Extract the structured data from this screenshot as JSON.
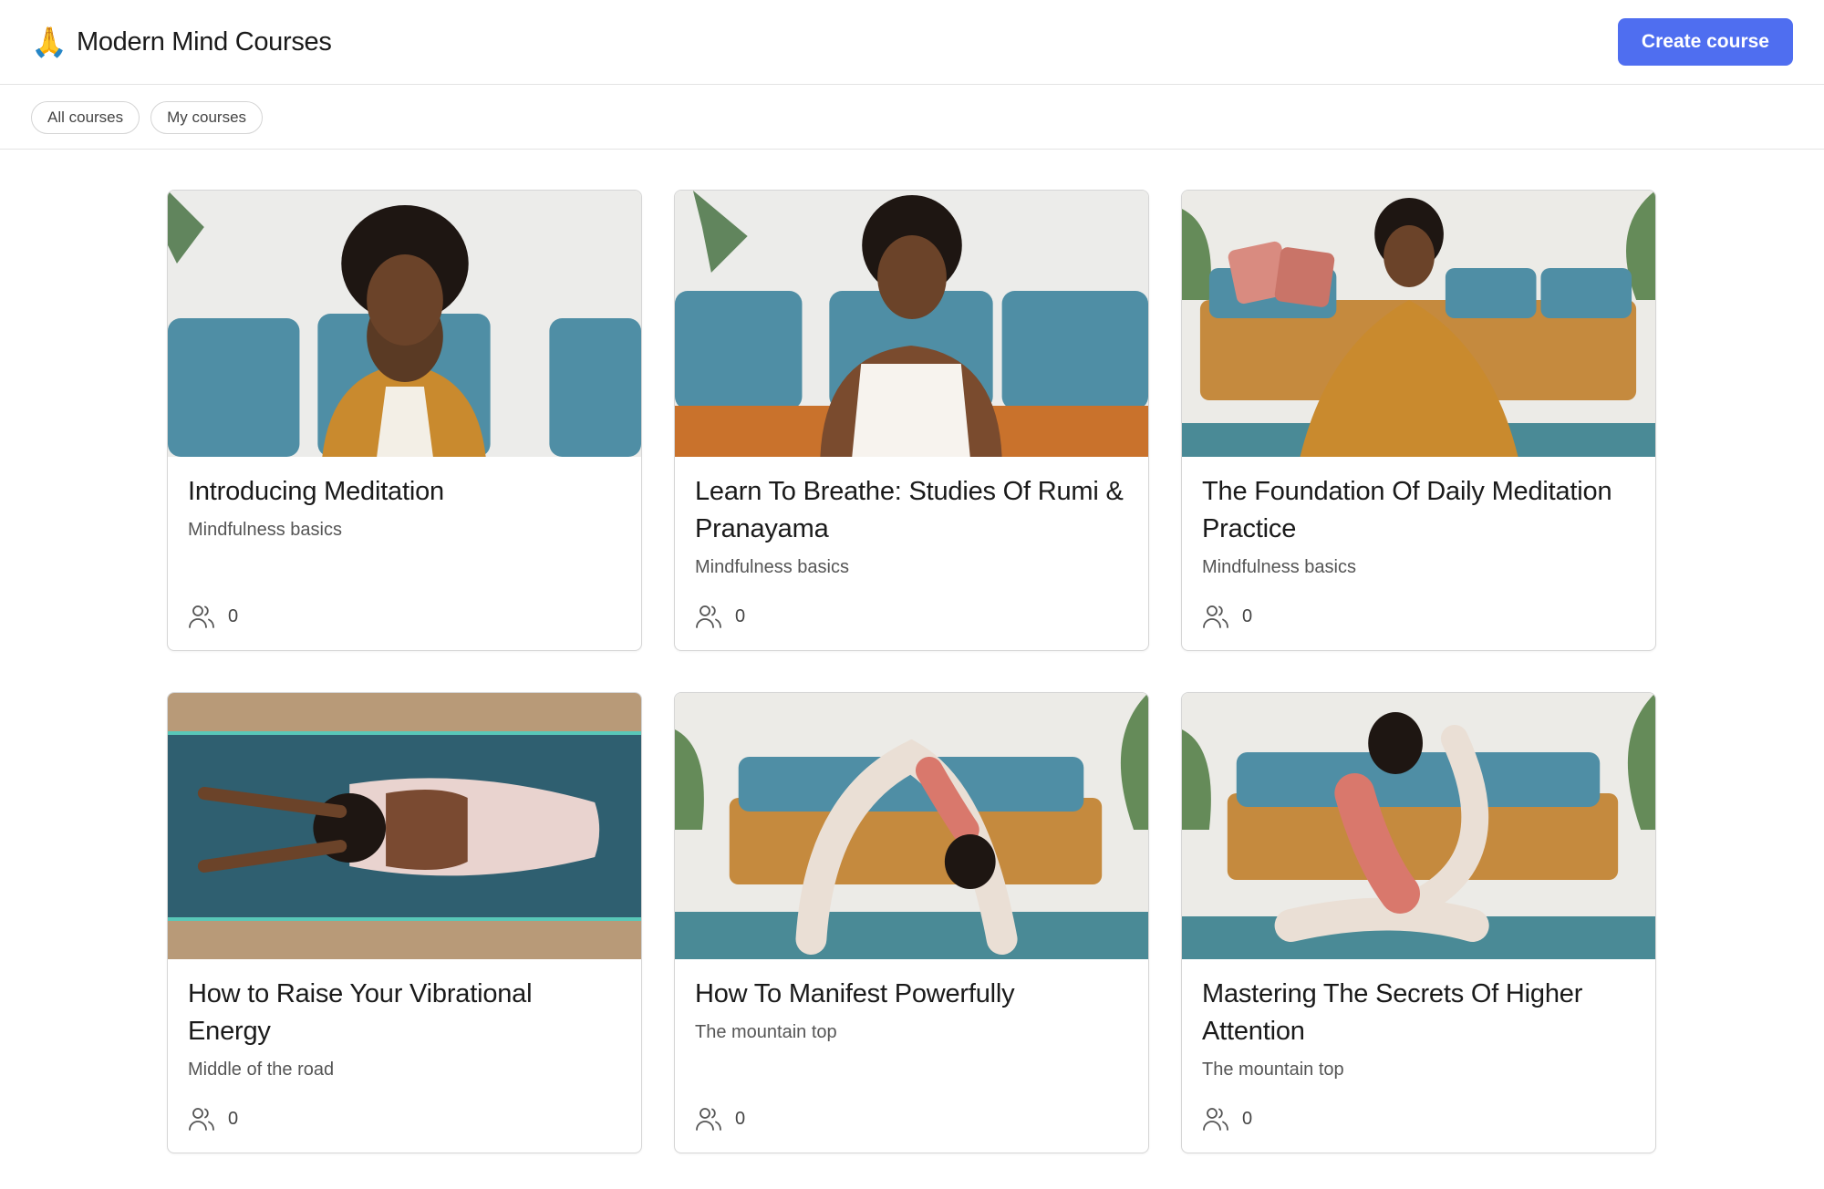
{
  "header": {
    "logo_emoji": "🙏",
    "title": "Modern Mind Courses",
    "create_label": "Create course"
  },
  "filters": [
    {
      "label": "All courses"
    },
    {
      "label": "My courses"
    }
  ],
  "courses": [
    {
      "title": "Introducing Meditation",
      "subtitle": "Mindfulness basics",
      "members": "0",
      "image": "smiling woman in orange cardigan seated before blue sofa"
    },
    {
      "title": "Learn To Breathe: Studies Of Rumi & Pranayama",
      "subtitle": "Mindfulness basics",
      "members": "0",
      "image": "smiling woman in white crop top before blue sofa"
    },
    {
      "title": "The Foundation Of Daily Meditation Practice",
      "subtitle": "Mindfulness basics",
      "members": "0",
      "image": "woman meditating cross-legged wrapped in mustard blanket"
    },
    {
      "title": "How to Raise Your Vibrational Energy",
      "subtitle": "Middle of the road",
      "members": "0",
      "image": "overhead view of woman in child's pose on yoga mat"
    },
    {
      "title": "How To Manifest Powerfully",
      "subtitle": "The mountain top",
      "members": "0",
      "image": "woman in wheel pose on blue yoga mat"
    },
    {
      "title": "Mastering The Secrets Of Higher Attention",
      "subtitle": "The mountain top",
      "members": "0",
      "image": "woman in pigeon pose in living room"
    }
  ],
  "colors": {
    "accent": "#4f6ef0",
    "sofa_blue": "#4f8ea5",
    "mustard": "#c98a2e",
    "mat_teal": "#4a8a96"
  }
}
